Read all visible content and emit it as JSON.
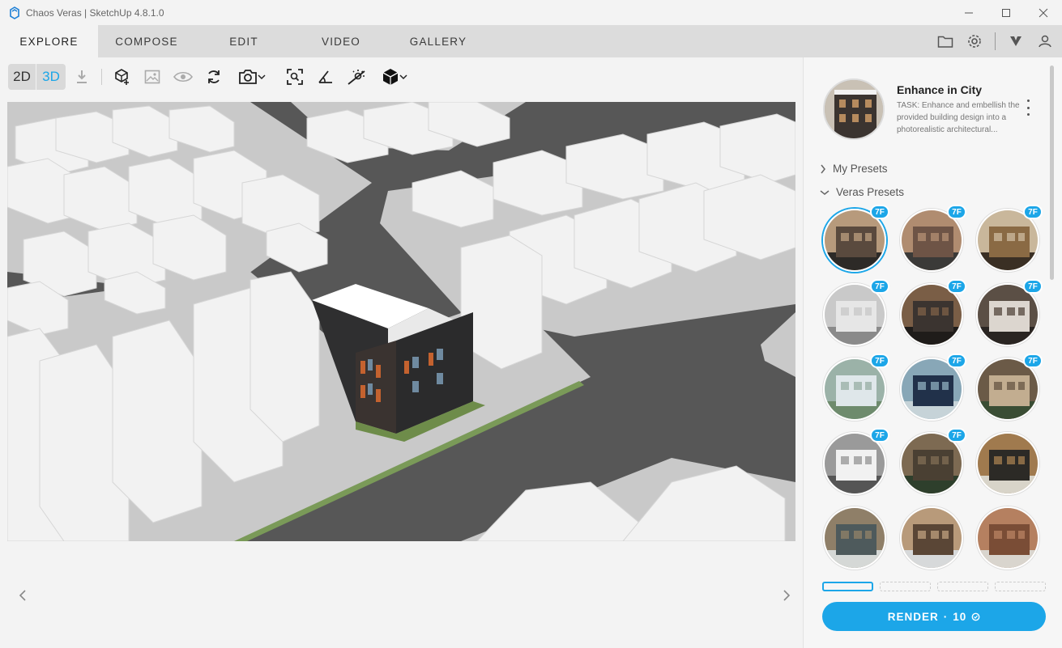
{
  "window": {
    "title": "Chaos Veras | SketchUp 4.8.1.0",
    "controls": [
      "minimize",
      "maximize",
      "close"
    ]
  },
  "tabs": [
    {
      "label": "EXPLORE",
      "active": true
    },
    {
      "label": "COMPOSE",
      "active": false
    },
    {
      "label": "EDIT",
      "active": false
    },
    {
      "label": "VIDEO",
      "active": false
    },
    {
      "label": "GALLERY",
      "active": false
    }
  ],
  "header_icons": [
    "folder-icon",
    "gear-icon",
    "veras-logo-icon",
    "user-icon"
  ],
  "toolbar": {
    "mode_2d": "2D",
    "mode_3d": "3D",
    "active_mode": "3D",
    "icons": [
      "download-icon",
      "add-geometry-icon",
      "image-icon",
      "eye-icon",
      "sync-icon",
      "camera-icon",
      "zoom-extents-icon",
      "angle-icon",
      "sun-icon",
      "material-icon"
    ]
  },
  "viewport": {
    "description_hidden": true
  },
  "preset": {
    "title": "Enhance in City",
    "description": "TASK: Enhance and embellish the provided building design into a photorealistic architectural..."
  },
  "sections": {
    "my_presets": "My Presets",
    "veras_presets": "Veras Presets"
  },
  "presets": [
    {
      "badge": "7F",
      "selected": true,
      "palette": [
        "#5a4a3e",
        "#b79a7c",
        "#2d2a27"
      ]
    },
    {
      "badge": "7F",
      "selected": false,
      "palette": [
        "#6e5446",
        "#b08c70",
        "#3b3a38"
      ]
    },
    {
      "badge": "7F",
      "selected": false,
      "palette": [
        "#8a6a44",
        "#c9b79b",
        "#3a2f24"
      ]
    },
    {
      "badge": "7F",
      "selected": false,
      "palette": [
        "#e6e6e6",
        "#c9c9c9",
        "#8a8a8a"
      ]
    },
    {
      "badge": "7F",
      "selected": false,
      "palette": [
        "#3b3430",
        "#7a5e46",
        "#1f1c1a"
      ]
    },
    {
      "badge": "7F",
      "selected": false,
      "palette": [
        "#dcd6cf",
        "#5b4f45",
        "#2a2522"
      ]
    },
    {
      "badge": "7F",
      "selected": false,
      "palette": [
        "#dfe7ea",
        "#9bb2a8",
        "#6e8b6d"
      ]
    },
    {
      "badge": "7F",
      "selected": false,
      "palette": [
        "#21314a",
        "#88a7b7",
        "#c6d3d8"
      ]
    },
    {
      "badge": "7F",
      "selected": false,
      "palette": [
        "#c2ad90",
        "#6b5a47",
        "#3a4d34"
      ]
    },
    {
      "badge": "7F",
      "selected": false,
      "palette": [
        "#f1f1f1",
        "#9a9a9a",
        "#555555"
      ]
    },
    {
      "badge": "7F",
      "selected": false,
      "palette": [
        "#4a4033",
        "#7d6a52",
        "#2e3f2c"
      ]
    },
    {
      "badge": "",
      "selected": false,
      "palette": [
        "#2c2a26",
        "#a07a4e",
        "#d8d4c9"
      ]
    },
    {
      "badge": "",
      "selected": false,
      "palette": [
        "#4e5a5c",
        "#8f7f68",
        "#d5d8d6"
      ]
    },
    {
      "badge": "",
      "selected": false,
      "palette": [
        "#5a4636",
        "#b89a7a",
        "#d7d9da"
      ]
    },
    {
      "badge": "",
      "selected": false,
      "palette": [
        "#7a4d36",
        "#b58060",
        "#d9d5ce"
      ]
    }
  ],
  "render": {
    "label": "RENDER",
    "separator": "·",
    "cost": "10"
  },
  "colors": {
    "accent": "#1ca6e8",
    "viewport_ground": "#575757",
    "building_white": "#f2f2f2"
  }
}
